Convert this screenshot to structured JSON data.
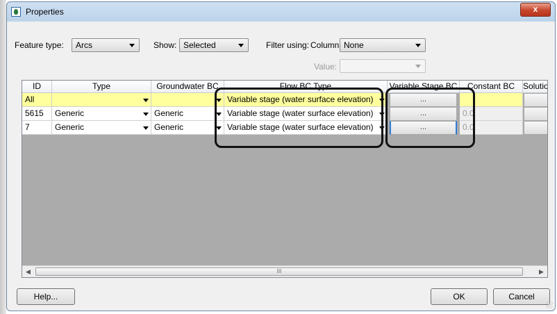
{
  "window": {
    "title": "Properties"
  },
  "filters": {
    "feature_type_label": "Feature type:",
    "feature_type_value": "Arcs",
    "show_label": "Show:",
    "show_value": "Selected",
    "filter_label": "Filter using:",
    "column_label": "Column:",
    "column_value": "None",
    "value_label": "Value:",
    "value_value": ""
  },
  "table": {
    "headers": [
      "ID",
      "Type",
      "Groundwater BC",
      "Flow BC Type",
      "Variable Stage BC",
      "Constant BC",
      "Solutio"
    ],
    "rows": [
      {
        "id": "All",
        "type": "",
        "groundwater": "",
        "flow": "Variable stage (water surface elevation)",
        "varstage": "...",
        "constant": ""
      },
      {
        "id": "5615",
        "type": "Generic",
        "groundwater": "Generic",
        "flow": "Variable stage (water surface elevation)",
        "varstage": "...",
        "constant": "0.0"
      },
      {
        "id": "7",
        "type": "Generic",
        "groundwater": "Generic",
        "flow": "Variable stage (water surface elevation)",
        "varstage": "...",
        "constant": "0.0"
      }
    ],
    "scroll_thumb_glyph": "III"
  },
  "buttons": {
    "help": "Help...",
    "ok": "OK",
    "cancel": "Cancel",
    "close": "x"
  },
  "colors": {
    "selected_row": "#ffff9e",
    "grid_background": "#ababab",
    "highlight_outline": "#111111"
  }
}
